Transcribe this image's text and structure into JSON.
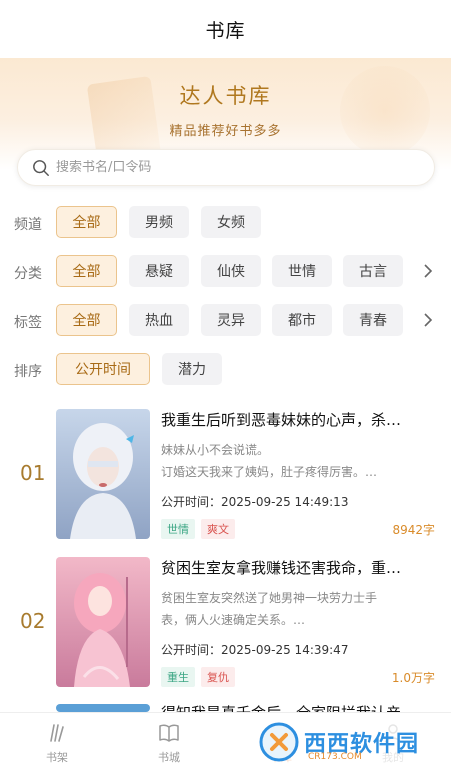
{
  "header": {
    "title": "书库"
  },
  "banner": {
    "title": "达人书库",
    "subtitle": "精品推荐好书多多"
  },
  "search": {
    "placeholder": "搜索书名/口令码"
  },
  "filters": {
    "channel": {
      "label": "频道",
      "options": [
        "全部",
        "男频",
        "女频"
      ],
      "selected": "全部"
    },
    "category": {
      "label": "分类",
      "options": [
        "全部",
        "悬疑",
        "仙侠",
        "世情",
        "古言"
      ],
      "selected": "全部"
    },
    "tag": {
      "label": "标签",
      "options": [
        "全部",
        "热血",
        "灵异",
        "都市",
        "青春"
      ],
      "selected": "全部"
    },
    "sort": {
      "label": "排序",
      "options": [
        "公开时间",
        "潜力"
      ],
      "selected": "公开时间"
    }
  },
  "books": [
    {
      "rank": "01",
      "title": "我重生后听到恶毒妹妹的心声，杀…",
      "desc_line1": "妹妹从小不会说谎。",
      "desc_line2": "订婚这天我来了姨妈，肚子疼得厉害。…",
      "time": "公开时间：2025-09-25 14:49:13",
      "tags": [
        "世情",
        "爽文"
      ],
      "words": "8942字"
    },
    {
      "rank": "02",
      "title": "贫困生室友拿我赚钱还害我命，重…",
      "desc_line1": "贫困生室友突然送了她男神一块劳力士手",
      "desc_line2": "表，俩人火速确定关系。…",
      "time": "公开时间：2025-09-25 14:39:47",
      "tags": [
        "重生",
        "复仇"
      ],
      "words": "1.0万字"
    },
    {
      "title": "得知我是真千金后，全家阻拦我认亲"
    }
  ],
  "tabbar": {
    "items": [
      {
        "label": "书架",
        "icon": "bookshelf-icon"
      },
      {
        "label": "书城",
        "icon": "book-city-icon"
      },
      {
        "label": "书库",
        "icon": "library-icon"
      },
      {
        "label": "我的",
        "icon": "profile-icon"
      }
    ]
  },
  "watermark": {
    "brand": "西西软件园",
    "sub": "CR173.COM"
  },
  "colors": {
    "accent": "#a86a15",
    "accent_bg": "#fdf0df",
    "green_tag": "#3aa583",
    "red_tag": "#d9534f",
    "word_count": "#d98b2a"
  }
}
